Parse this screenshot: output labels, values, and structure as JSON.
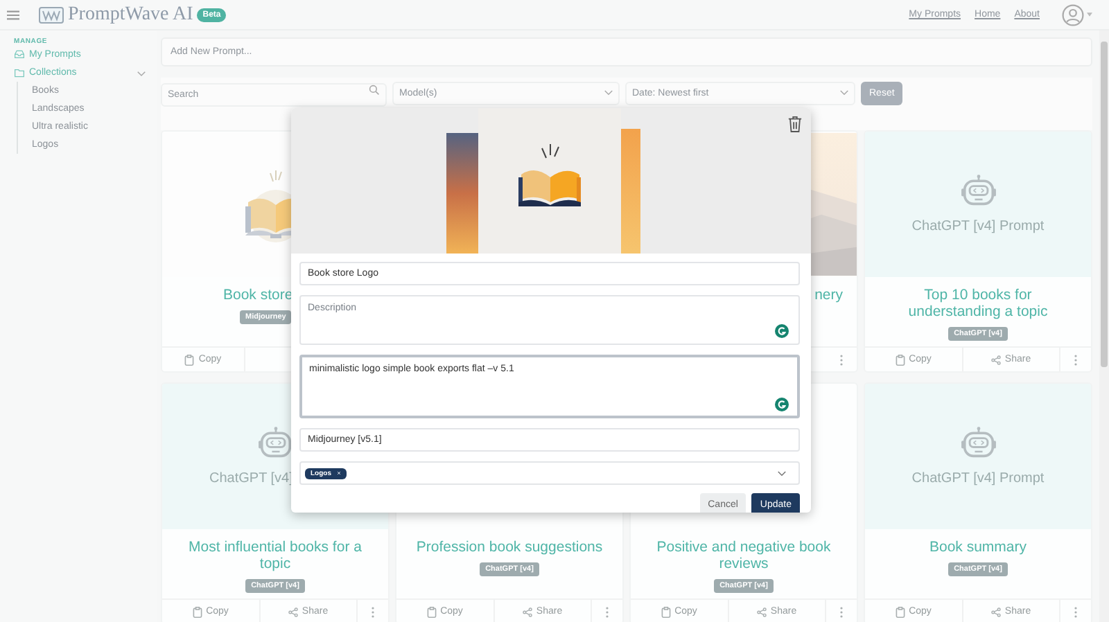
{
  "header": {
    "brand": "PromptWave AI",
    "badge": "Beta",
    "nav": [
      {
        "label": "My Prompts"
      },
      {
        "label": "Home"
      },
      {
        "label": "About"
      }
    ]
  },
  "sidebar": {
    "section": "MANAGE",
    "items": [
      {
        "label": "My Prompts"
      },
      {
        "label": "Collections",
        "expanded": true,
        "children": [
          {
            "label": "Books"
          },
          {
            "label": "Landscapes"
          },
          {
            "label": "Ultra realistic"
          },
          {
            "label": "Logos"
          }
        ]
      }
    ]
  },
  "new_prompt": {
    "placeholder": "Add New Prompt..."
  },
  "filters": {
    "search": {
      "placeholder": "Search"
    },
    "selects": [
      {
        "placeholder": "Model(s)"
      },
      {
        "value": "Date: Newest first"
      }
    ],
    "reset": {
      "label": "Reset",
      "disabled": true
    }
  },
  "cards": [
    {
      "media": {
        "kind": "book"
      },
      "title": "Book store",
      "badge": "Midjourney",
      "actions": [
        {
          "kind": "copy",
          "label": "Copy"
        }
      ]
    },
    {
      "media": {
        "kind": "landscape"
      },
      "title": "nery",
      "actions": [
        {
          "kind": "more"
        }
      ]
    },
    {
      "media": {
        "kind": "robot",
        "caption": "ChatGPT [v4] Prompt"
      },
      "title": "Top 10 books for understanding a topic",
      "badge": "ChatGPT [v4]",
      "actions": [
        {
          "kind": "copy",
          "label": "Copy"
        },
        {
          "kind": "share",
          "label": "Share"
        },
        {
          "kind": "more"
        }
      ]
    },
    {
      "media": {
        "kind": "robot",
        "caption": "ChatGPT [v4]"
      },
      "title": "Most influential books for a topic",
      "badge": "ChatGPT [v4]",
      "actions": [
        {
          "kind": "copy",
          "label": "Copy"
        },
        {
          "kind": "share",
          "label": "Share"
        },
        {
          "kind": "more"
        }
      ]
    },
    {
      "title": "Profession book suggestions",
      "badge": "ChatGPT [v4]",
      "actions": [
        {
          "kind": "copy",
          "label": "Copy"
        },
        {
          "kind": "share",
          "label": "Share"
        },
        {
          "kind": "more"
        }
      ]
    },
    {
      "title": "Positive and negative book reviews",
      "badge": "ChatGPT [v4]",
      "actions": [
        {
          "kind": "copy",
          "label": "Copy"
        },
        {
          "kind": "share",
          "label": "Share"
        },
        {
          "kind": "more"
        }
      ]
    },
    {
      "media": {
        "kind": "robot",
        "caption": "ChatGPT [v4] Prompt"
      },
      "title": "Book summary",
      "badge": "ChatGPT [v4]",
      "actions": [
        {
          "kind": "copy",
          "label": "Copy"
        },
        {
          "kind": "share",
          "label": "Share"
        },
        {
          "kind": "more"
        }
      ]
    }
  ],
  "dialog": {
    "title_value": "Book store Logo",
    "description": {
      "placeholder": "Description"
    },
    "prompt": {
      "value": "minimalistic logo simple book exports flat –v 5.1",
      "focused": true
    },
    "model_value": "Midjourney [v5.1]",
    "tags": [
      {
        "label": "Logos"
      }
    ],
    "buttons": [
      {
        "kind": "secondary",
        "label": "Cancel"
      },
      {
        "kind": "primary",
        "label": "Update"
      }
    ]
  }
}
